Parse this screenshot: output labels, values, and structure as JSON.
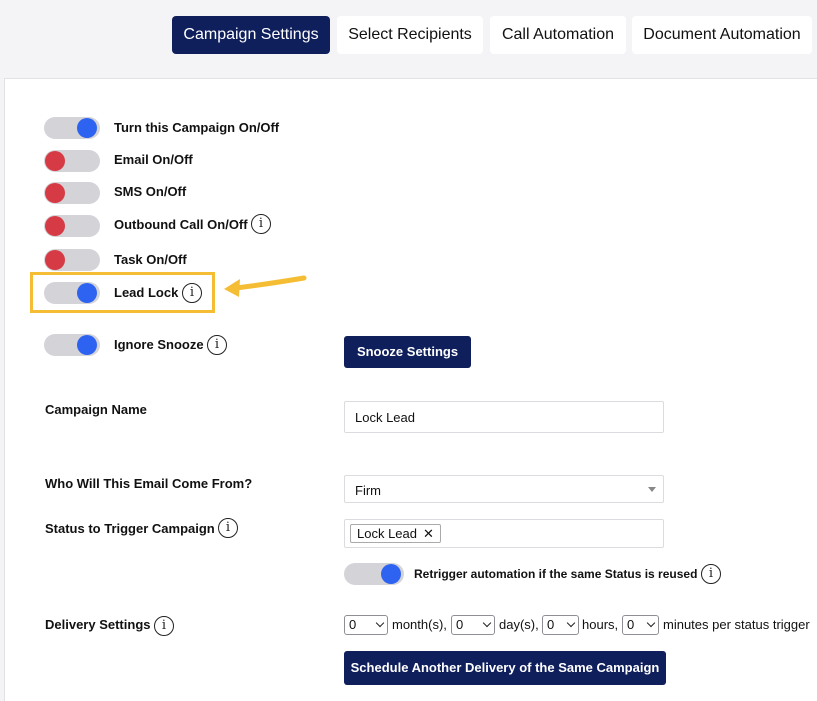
{
  "tabs": [
    {
      "label": "Campaign Settings",
      "active": true
    },
    {
      "label": "Select Recipients",
      "active": false
    },
    {
      "label": "Call Automation",
      "active": false
    },
    {
      "label": "Document Automation",
      "active": false
    }
  ],
  "toggles": [
    {
      "label": "Turn this Campaign On/Off",
      "state": "on"
    },
    {
      "label": "Email On/Off",
      "state": "off"
    },
    {
      "label": "SMS On/Off",
      "state": "off"
    },
    {
      "label": "Outbound Call On/Off",
      "state": "off",
      "info_icon": true
    },
    {
      "label": "Task On/Off",
      "state": "off"
    },
    {
      "label": "Lead Lock",
      "state": "on",
      "info_icon": true,
      "highlighted": true
    },
    {
      "label": "Ignore Snooze",
      "state": "on",
      "info_icon": true
    }
  ],
  "info_glyph": "i",
  "snooze_button": "Snooze Settings",
  "campaign_name": {
    "label": "Campaign Name",
    "value": "Lock Lead"
  },
  "email_from": {
    "label": "Who Will This Email Come From?",
    "value": "Firm"
  },
  "status_trigger": {
    "label": "Status to Trigger Campaign",
    "chips": [
      "Lock Lead"
    ],
    "chip_remove": "✕"
  },
  "retrigger": {
    "label": "Retrigger automation if the same Status is reused",
    "state": "on"
  },
  "delivery": {
    "label": "Delivery Settings",
    "months": "0",
    "months_unit": "month(s),",
    "days": "0",
    "days_unit": "day(s),",
    "hours": "0",
    "hours_unit": "hours,",
    "minutes": "0",
    "minutes_unit": "minutes per status trigger"
  },
  "schedule_button": "Schedule Another Delivery of the Same Campaign",
  "colors": {
    "navy": "#0f1f5c",
    "toggle_on": "#2d63f0",
    "toggle_off": "#d63a44",
    "highlight": "#f5bd33"
  }
}
